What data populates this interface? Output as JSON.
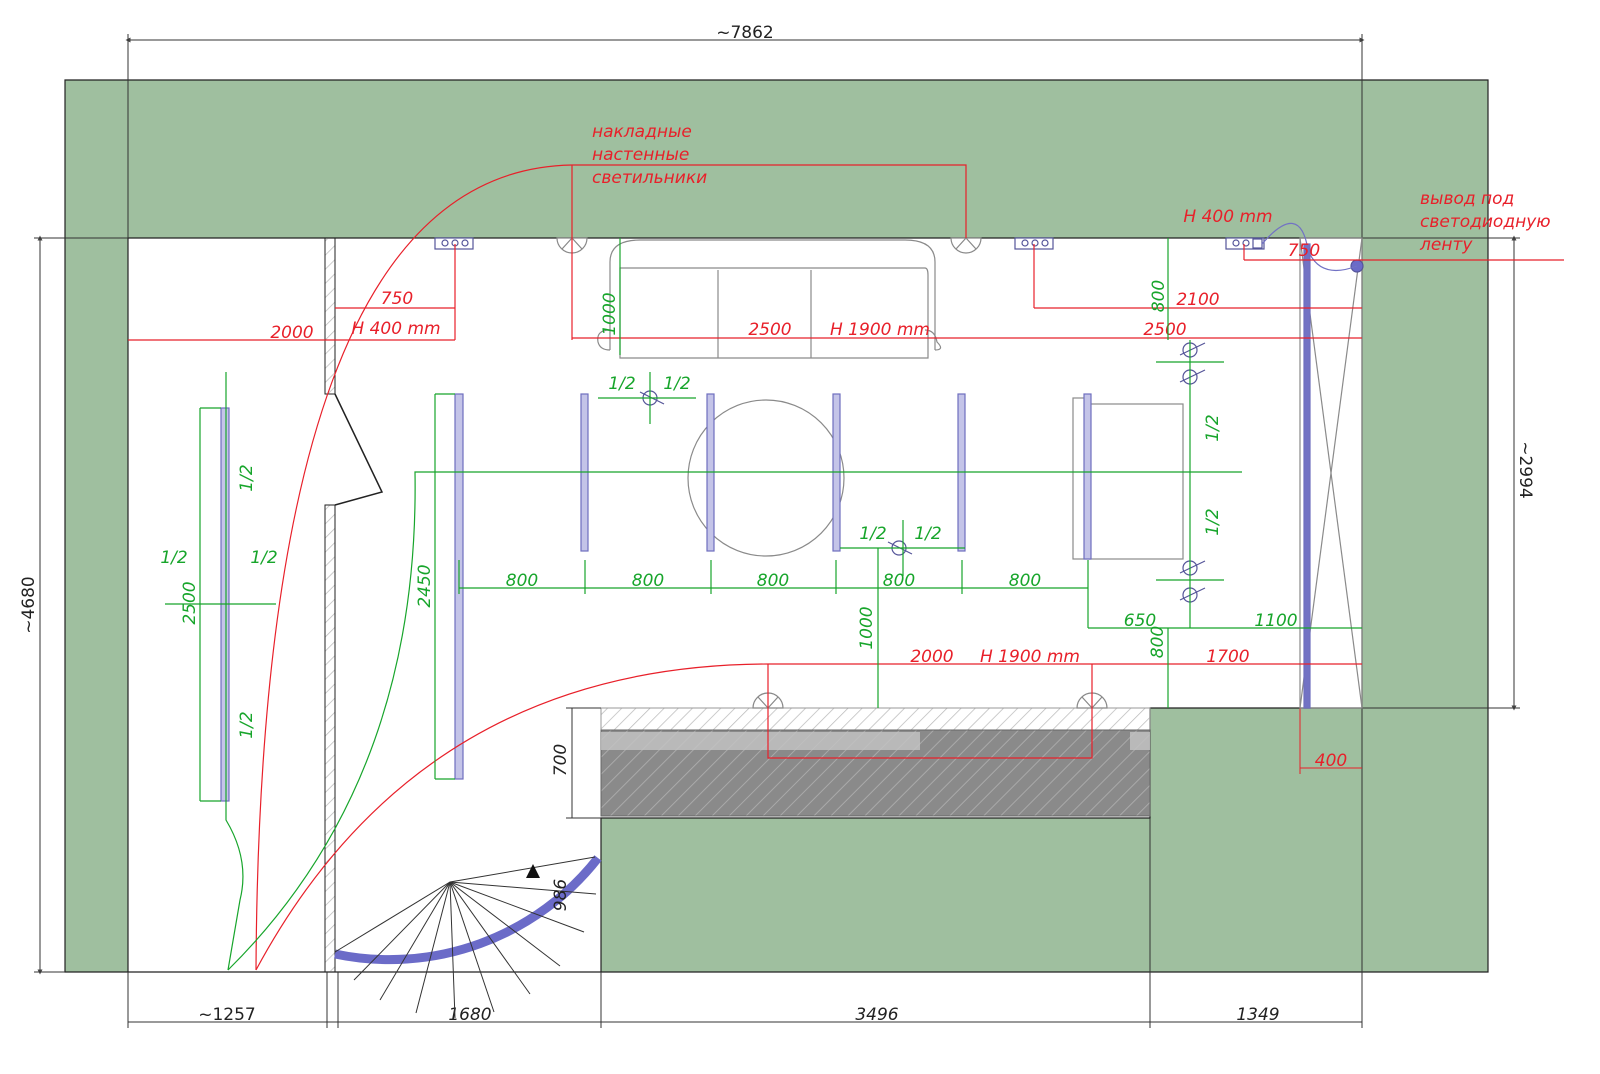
{
  "colors": {
    "wall": "#9fbf9f",
    "dim_line": "#333333",
    "green_annot": "#17a52b",
    "red_annot": "#e8202a",
    "furniture": "#8a8a8a",
    "blue_fixture": "#7272c4",
    "stair_arc": "#6b6bc8"
  },
  "dims": {
    "top_total": "~7862",
    "left_total": "~4680",
    "right_total": "~2994",
    "bottom_1": "~1257",
    "bottom_2": "1680",
    "bottom_3": "3496",
    "bottom_4": "1349",
    "right_offset": "400",
    "niche_depth": "700",
    "stair_step": "986"
  },
  "labels": {
    "wall_lights": [
      "накладные",
      "настенные",
      "светильники"
    ],
    "led_output": [
      "вывод под",
      "светодиодную",
      "ленту"
    ]
  },
  "red_dims": {
    "top_sofa_width": "2500",
    "top_sofa_height": "H 1900 mm",
    "left_depth": "2000",
    "left_offset": "750",
    "left_height": "H 400 mm",
    "right_height": "H 400 mm",
    "right_offset": "750",
    "right_width": "2100",
    "right_run": "2500",
    "bottom_width": "2000",
    "bottom_height": "H 1900 mm",
    "bottom_right": "1700"
  },
  "green_dims": {
    "half": "1/2",
    "left_panel": "2500",
    "sofa_depth": "1000",
    "right_top": "800",
    "left_light_run": "2450",
    "spacing": [
      "800",
      "800",
      "800",
      "800",
      "800"
    ],
    "gap_650": "650",
    "gap_1100": "1100",
    "bottom_1000": "1000",
    "bottom_800": "800"
  }
}
